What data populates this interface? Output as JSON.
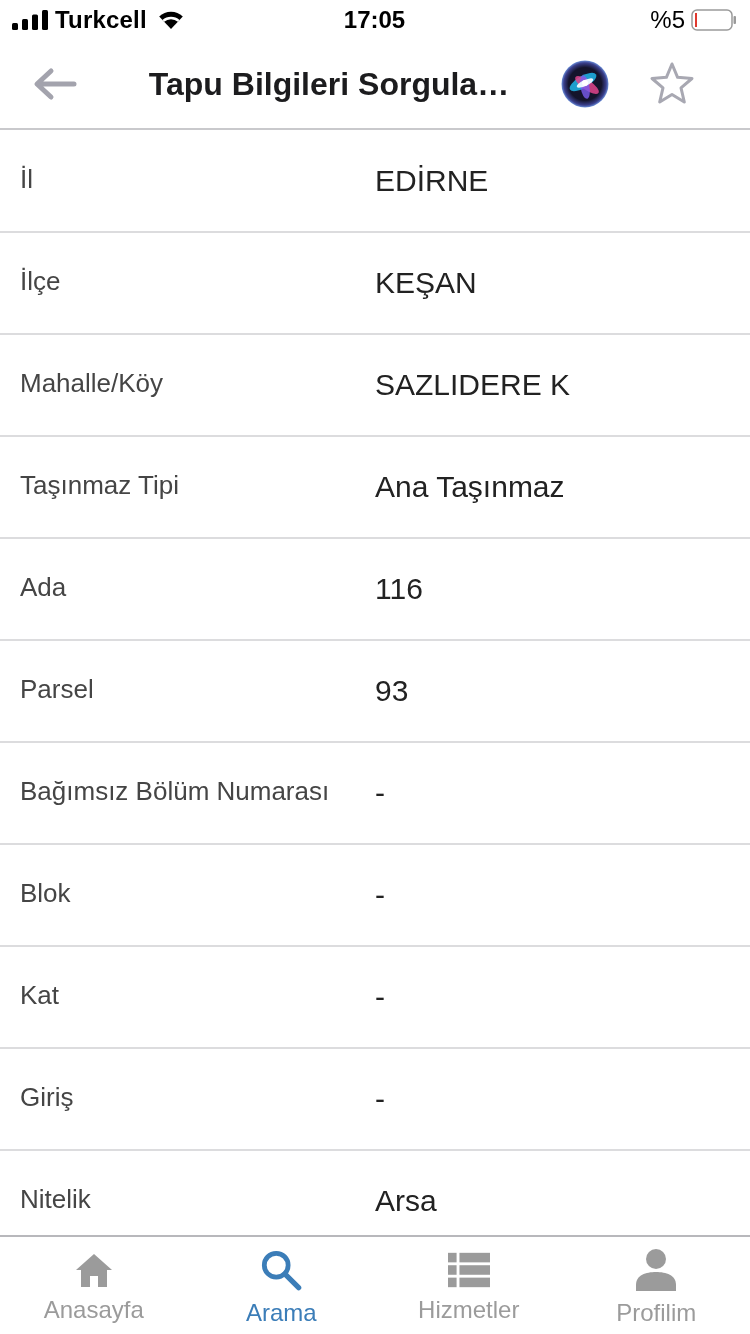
{
  "status_bar": {
    "carrier": "Turkcell",
    "time": "17:05",
    "battery": "%5"
  },
  "nav": {
    "title": "Tapu Bilgileri Sorgula…"
  },
  "fields": [
    {
      "label": "İl",
      "value": "EDİRNE"
    },
    {
      "label": "İlçe",
      "value": "KEŞAN"
    },
    {
      "label": "Mahalle/Köy",
      "value": "SAZLIDERE K"
    },
    {
      "label": "Taşınmaz Tipi",
      "value": "Ana Taşınmaz"
    },
    {
      "label": "Ada",
      "value": "116"
    },
    {
      "label": "Parsel",
      "value": "93"
    },
    {
      "label": "Bağımsız Bölüm Numarası",
      "value": "-"
    },
    {
      "label": "Blok",
      "value": "-"
    },
    {
      "label": "Kat",
      "value": "-"
    },
    {
      "label": "Giriş",
      "value": "-"
    },
    {
      "label": "Nitelik",
      "value": "Arsa"
    }
  ],
  "tab_bar": [
    {
      "kind": "home",
      "label": "Anasayfa",
      "selected": false
    },
    {
      "kind": "search",
      "label": "Arama",
      "selected": true
    },
    {
      "kind": "list",
      "label": "Hizmetler",
      "selected": false
    },
    {
      "kind": "person",
      "label": "Profilim",
      "selected": false
    }
  ]
}
